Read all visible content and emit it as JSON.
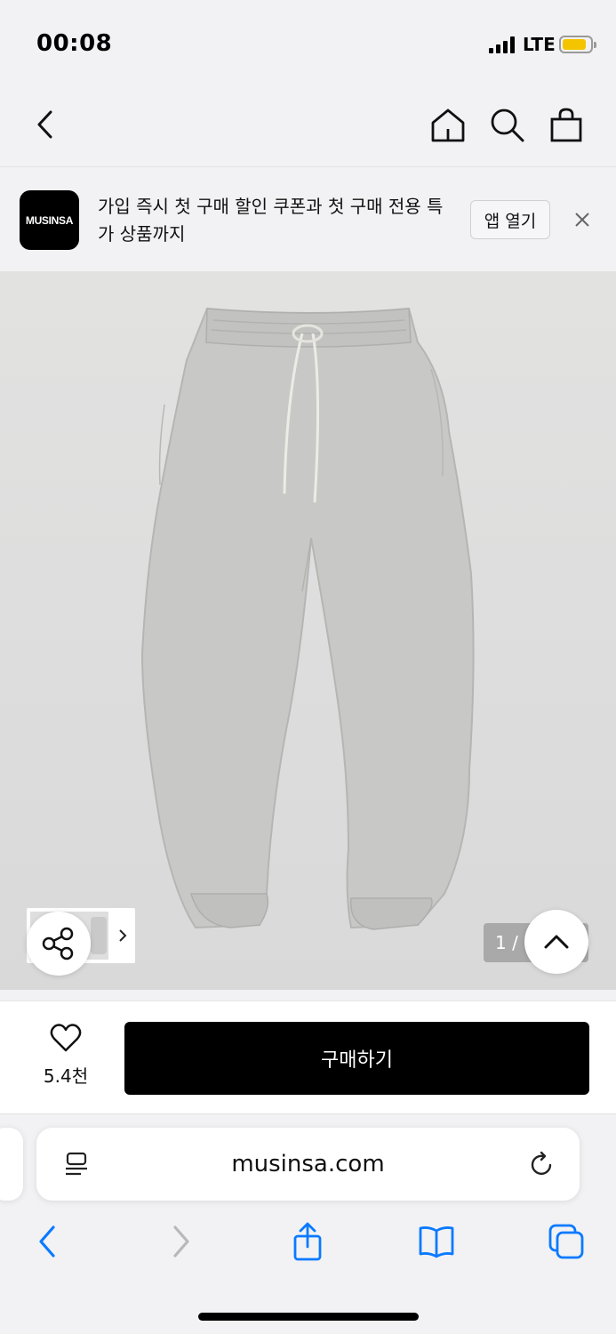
{
  "status": {
    "time": "00:08",
    "network": "LTE"
  },
  "app_banner": {
    "logo_text": "MUSINSA",
    "message": "가입 즉시 첫 구매 할인 쿠폰과 첫 구매 전용 특가 상품까지",
    "open_app_label": "앱 열기"
  },
  "product": {
    "image_counter": "1 /"
  },
  "purchase_bar": {
    "like_count": "5.4천",
    "buy_label": "구매하기"
  },
  "browser": {
    "url": "musinsa.com"
  },
  "colors": {
    "accent_black": "#000000",
    "battery": "#f5c400",
    "safari_blue": "#0a7aff"
  },
  "icons": [
    "back-icon",
    "home-icon",
    "search-icon",
    "bag-icon",
    "close-icon",
    "share-icon",
    "chevron-up-icon",
    "heart-icon",
    "reader-icon",
    "reload-icon",
    "safari-back-icon",
    "safari-forward-icon",
    "share-sheet-icon",
    "bookmarks-icon",
    "tabs-icon"
  ]
}
